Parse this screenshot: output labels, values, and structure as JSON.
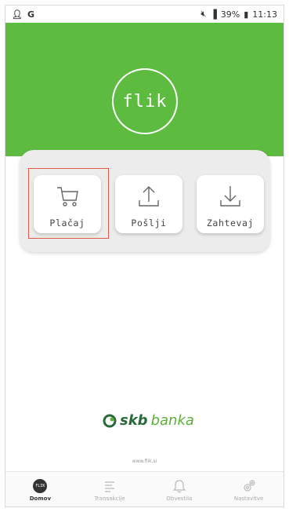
{
  "status_bar": {
    "left_icons": [
      "person-icon",
      "google-icon"
    ],
    "left_letter": "G",
    "battery": "39%",
    "time": "11:13"
  },
  "hero": {
    "logo_text": "flik",
    "background_color": "#5dbb3f"
  },
  "actions": [
    {
      "label": "Plačaj",
      "icon": "cart-icon"
    },
    {
      "label": "Pošlji",
      "icon": "upload-icon"
    },
    {
      "label": "Zahtevaj",
      "icon": "download-icon"
    }
  ],
  "bank": {
    "name_bold": "skb",
    "name_light": "banka",
    "website": "www.flik.si"
  },
  "bottom_nav": {
    "items": [
      {
        "label": "Domov",
        "icon": "flik-icon",
        "active": true
      },
      {
        "label": "Transakcije",
        "icon": "list-icon",
        "active": false
      },
      {
        "label": "Obvestila",
        "icon": "bell-icon",
        "active": false
      },
      {
        "label": "Nastavitve",
        "icon": "gear-icon",
        "active": false
      }
    ],
    "home_icon_text": "FLIK"
  },
  "colors": {
    "brand_green": "#5dbb3f",
    "highlight_red": "#e05a45"
  }
}
